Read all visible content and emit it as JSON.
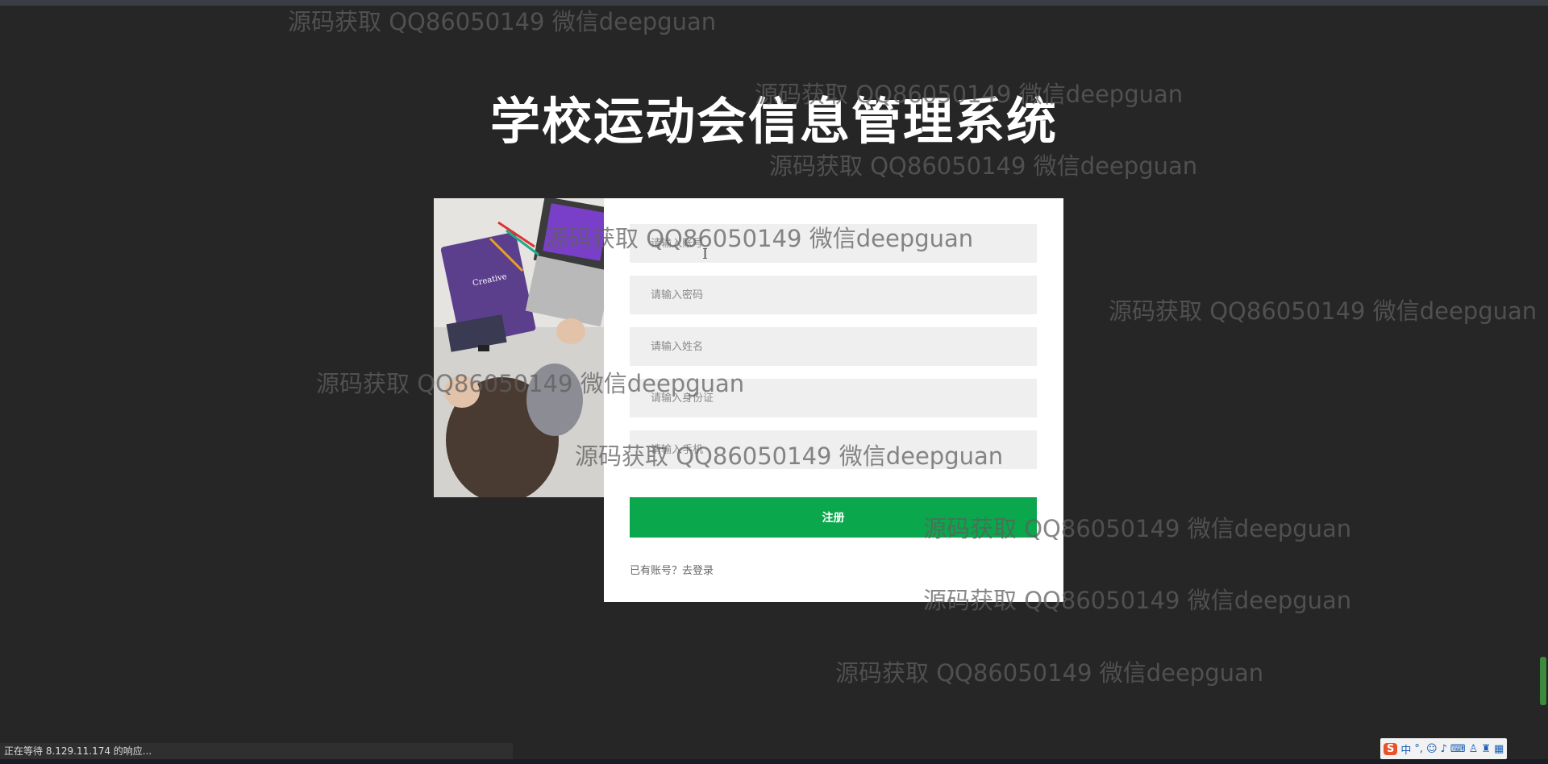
{
  "title": "学校运动会信息管理系统",
  "form": {
    "fields": [
      {
        "name": "account",
        "placeholder": "请输入账号"
      },
      {
        "name": "password",
        "placeholder": "请输入密码"
      },
      {
        "name": "fullname",
        "placeholder": "请输入姓名"
      },
      {
        "name": "idcard",
        "placeholder": "请输入身份证"
      },
      {
        "name": "phone",
        "placeholder": "请输入手机"
      }
    ],
    "submit_label": "注册",
    "login_link": "已有账号？去登录"
  },
  "watermark_text": "源码获取 QQ86050149 微信deepguan",
  "status_text": "正在等待 8.129.11.174 的响应...",
  "ime": {
    "logo": "S",
    "mode": "中"
  },
  "colors": {
    "background": "#262626",
    "accent": "#0aa74c",
    "card": "#ffffff",
    "field": "#efefef"
  }
}
